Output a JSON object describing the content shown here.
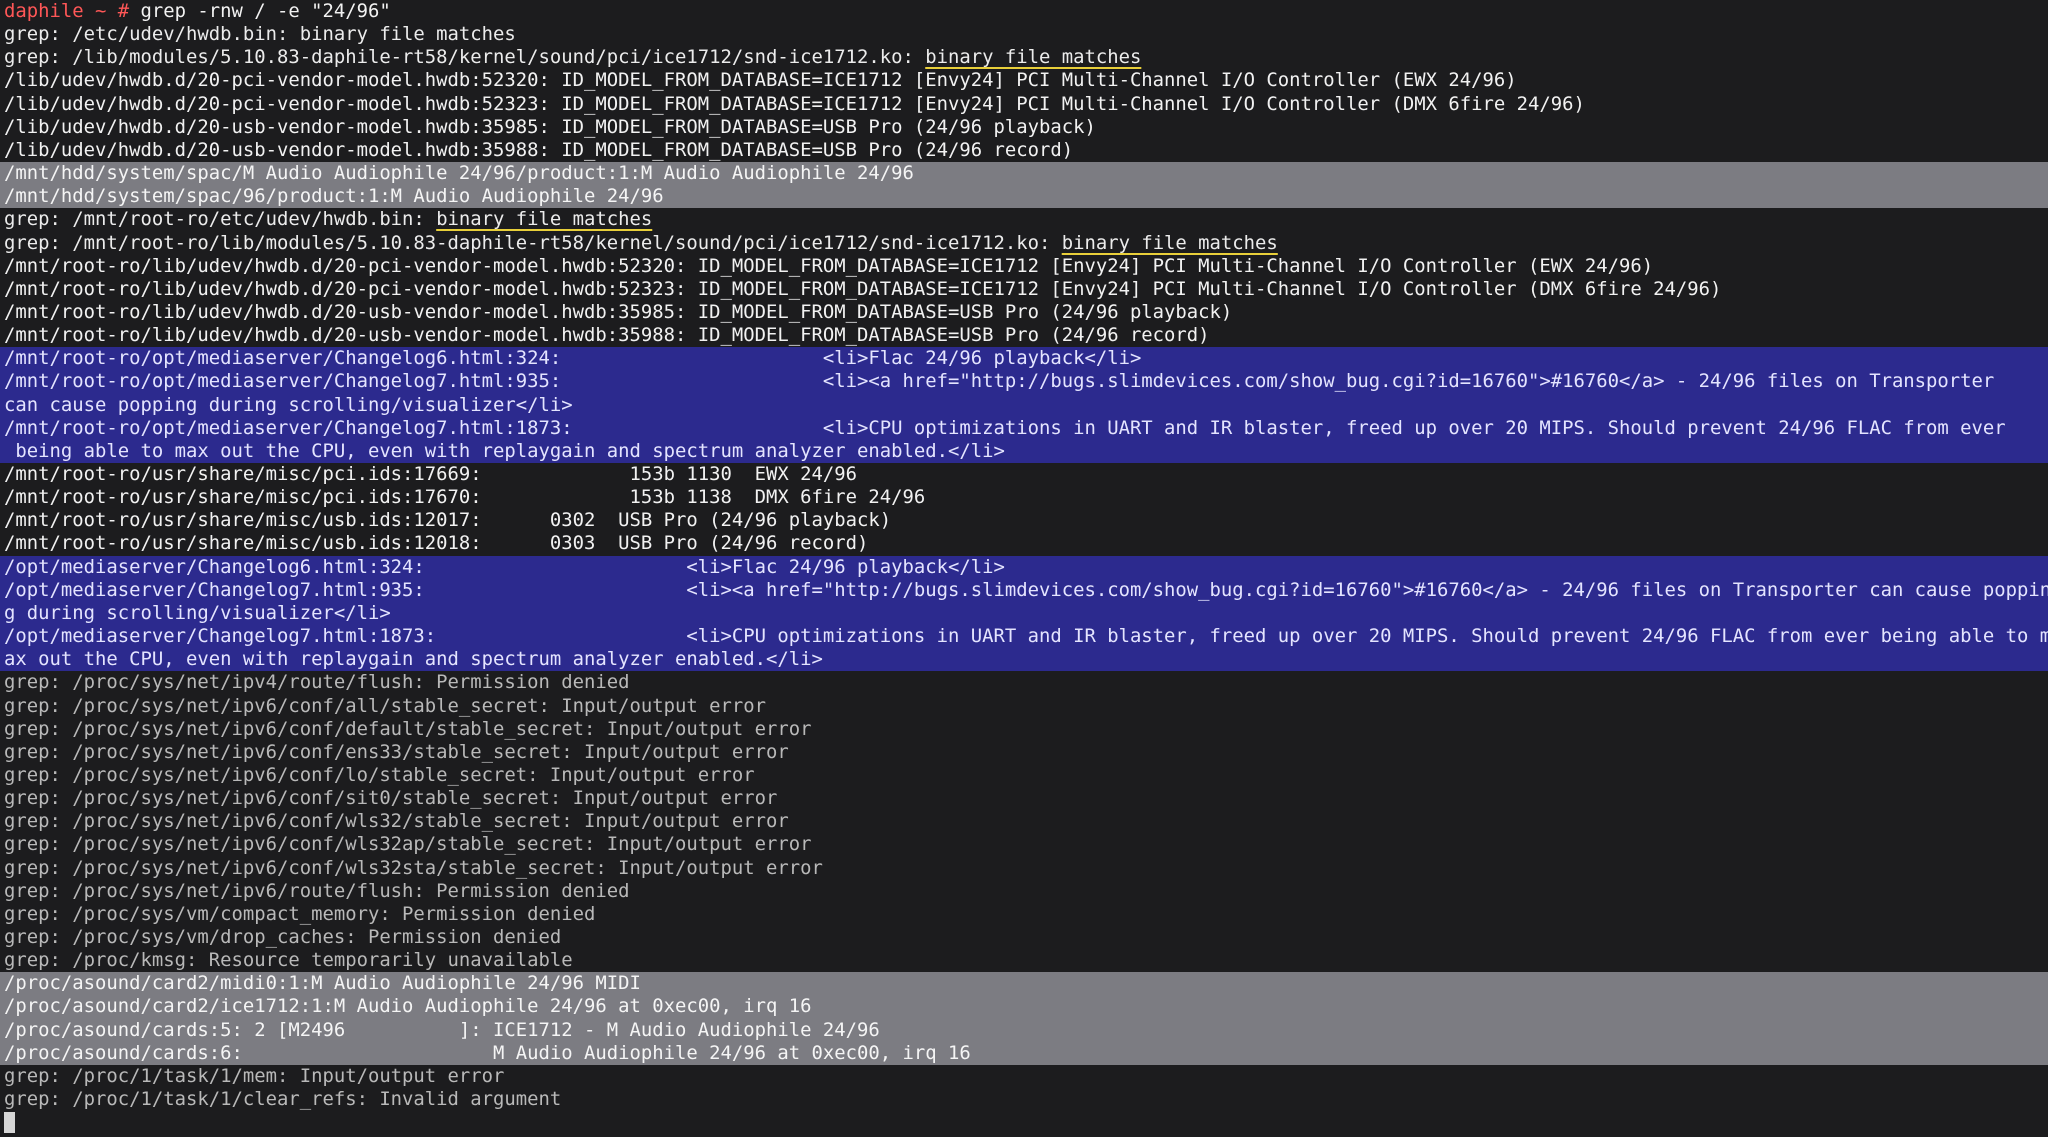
{
  "prompt": {
    "host": "daphile",
    "path_and_symbol": " ~ # ",
    "command": "grep -rnw / -e \"24/96\""
  },
  "lines": [
    {
      "style": "normal",
      "segments": [
        {
          "t": "grep: /etc/udev/hwdb.bin: binary file matches"
        }
      ]
    },
    {
      "style": "normal",
      "segments": [
        {
          "t": "grep: /lib/modules/5.10.83-daphile-rt58/kernel/sound/pci/ice1712/snd-ice1712.ko: "
        },
        {
          "t": "binary file matches",
          "hl": true
        }
      ]
    },
    {
      "style": "bright",
      "segments": [
        {
          "t": "/lib/udev/hwdb.d/20-pci-vendor-model.hwdb:52320: ID_MODEL_FROM_DATABASE=ICE1712 [Envy24] PCI Multi-Channel I/O Controller (EWX 24/96)"
        }
      ]
    },
    {
      "style": "bright",
      "segments": [
        {
          "t": "/lib/udev/hwdb.d/20-pci-vendor-model.hwdb:52323: ID_MODEL_FROM_DATABASE=ICE1712 [Envy24] PCI Multi-Channel I/O Controller (DMX 6fire 24/96)"
        }
      ]
    },
    {
      "style": "bright",
      "segments": [
        {
          "t": "/lib/udev/hwdb.d/20-usb-vendor-model.hwdb:35985: ID_MODEL_FROM_DATABASE=USB Pro (24/96 playback)"
        }
      ]
    },
    {
      "style": "bright",
      "segments": [
        {
          "t": "/lib/udev/hwdb.d/20-usb-vendor-model.hwdb:35988: ID_MODEL_FROM_DATABASE=USB Pro (24/96 record)"
        }
      ]
    },
    {
      "style": "gray",
      "segments": [
        {
          "t": "/mnt/hdd/system/spac/M Audio Audiophile 24/96/product:1:M Audio Audiophile 24/96"
        }
      ]
    },
    {
      "style": "gray",
      "segments": [
        {
          "t": "/mnt/hdd/system/spac/96/product:1:M Audio Audiophile 24/96"
        }
      ]
    },
    {
      "style": "normal",
      "segments": [
        {
          "t": "grep: /mnt/root-ro/etc/udev/hwdb.bin: "
        },
        {
          "t": "binary file matches",
          "hl": true
        }
      ]
    },
    {
      "style": "normal",
      "segments": [
        {
          "t": "grep: /mnt/root-ro/lib/modules/5.10.83-daphile-rt58/kernel/sound/pci/ice1712/snd-ice1712.ko: "
        },
        {
          "t": "binary file matches",
          "hl": true
        }
      ]
    },
    {
      "style": "bright",
      "segments": [
        {
          "t": "/mnt/root-ro/lib/udev/hwdb.d/20-pci-vendor-model.hwdb:52320: ID_MODEL_FROM_DATABASE=ICE1712 [Envy24] PCI Multi-Channel I/O Controller (EWX 24/96)"
        }
      ]
    },
    {
      "style": "bright",
      "segments": [
        {
          "t": "/mnt/root-ro/lib/udev/hwdb.d/20-pci-vendor-model.hwdb:52323: ID_MODEL_FROM_DATABASE=ICE1712 [Envy24] PCI Multi-Channel I/O Controller (DMX 6fire 24/96)"
        }
      ]
    },
    {
      "style": "bright",
      "segments": [
        {
          "t": "/mnt/root-ro/lib/udev/hwdb.d/20-usb-vendor-model.hwdb:35985: ID_MODEL_FROM_DATABASE=USB Pro (24/96 playback)"
        }
      ]
    },
    {
      "style": "bright",
      "segments": [
        {
          "t": "/mnt/root-ro/lib/udev/hwdb.d/20-usb-vendor-model.hwdb:35988: ID_MODEL_FROM_DATABASE=USB Pro (24/96 record)"
        }
      ]
    },
    {
      "style": "blue",
      "segments": [
        {
          "t": "/mnt/root-ro/opt/mediaserver/Changelog6.html:324:                       <li>Flac 24/96 playback</li>"
        }
      ]
    },
    {
      "style": "blue",
      "segments": [
        {
          "t": "/mnt/root-ro/opt/mediaserver/Changelog7.html:935:                       <li><a href=\"http://bugs.slimdevices.com/show_bug.cgi?id=16760\">#16760</a> - 24/96 files on Transporter"
        }
      ]
    },
    {
      "style": "blue",
      "segments": [
        {
          "t": "can cause popping during scrolling/visualizer</li>"
        }
      ]
    },
    {
      "style": "blue",
      "segments": [
        {
          "t": "/mnt/root-ro/opt/mediaserver/Changelog7.html:1873:                      <li>CPU optimizations in UART and IR blaster, freed up over 20 MIPS. Should prevent 24/96 FLAC from ever"
        }
      ]
    },
    {
      "style": "blue",
      "segments": [
        {
          "t": " being able to max out the CPU, even with replaygain and spectrum analyzer enabled.</li>"
        }
      ]
    },
    {
      "style": "bright",
      "segments": [
        {
          "t": "/mnt/root-ro/usr/share/misc/pci.ids:17669:             153b 1130  EWX 24/96"
        }
      ]
    },
    {
      "style": "bright",
      "segments": [
        {
          "t": "/mnt/root-ro/usr/share/misc/pci.ids:17670:             153b 1138  DMX 6fire 24/96"
        }
      ]
    },
    {
      "style": "bright",
      "segments": [
        {
          "t": "/mnt/root-ro/usr/share/misc/usb.ids:12017:      0302  USB Pro (24/96 playback)"
        }
      ]
    },
    {
      "style": "bright",
      "segments": [
        {
          "t": "/mnt/root-ro/usr/share/misc/usb.ids:12018:      0303  USB Pro (24/96 record)"
        }
      ]
    },
    {
      "style": "blue",
      "segments": [
        {
          "t": "/opt/mediaserver/Changelog6.html:324:                       <li>Flac 24/96 playback</li>"
        }
      ]
    },
    {
      "style": "blue",
      "segments": [
        {
          "t": "/opt/mediaserver/Changelog7.html:935:                       <li><a href=\"http://bugs.slimdevices.com/show_bug.cgi?id=16760\">#16760</a> - 24/96 files on Transporter can cause poppin"
        }
      ]
    },
    {
      "style": "blue",
      "segments": [
        {
          "t": "g during scrolling/visualizer</li>"
        }
      ]
    },
    {
      "style": "blue",
      "segments": [
        {
          "t": "/opt/mediaserver/Changelog7.html:1873:                      <li>CPU optimizations in UART and IR blaster, freed up over 20 MIPS. Should prevent 24/96 FLAC from ever being able to m"
        }
      ]
    },
    {
      "style": "blue",
      "segments": [
        {
          "t": "ax out the CPU, even with replaygain and spectrum analyzer enabled.</li>"
        }
      ]
    },
    {
      "style": "dim",
      "segments": [
        {
          "t": "grep: /proc/sys/net/ipv4/route/flush: Permission denied"
        }
      ]
    },
    {
      "style": "dim",
      "segments": [
        {
          "t": "grep: /proc/sys/net/ipv6/conf/all/stable_secret: Input/output error"
        }
      ]
    },
    {
      "style": "dim",
      "segments": [
        {
          "t": "grep: /proc/sys/net/ipv6/conf/default/stable_secret: Input/output error"
        }
      ]
    },
    {
      "style": "dim",
      "segments": [
        {
          "t": "grep: /proc/sys/net/ipv6/conf/ens33/stable_secret: Input/output error"
        }
      ]
    },
    {
      "style": "dim",
      "segments": [
        {
          "t": "grep: /proc/sys/net/ipv6/conf/lo/stable_secret: Input/output error"
        }
      ]
    },
    {
      "style": "dim",
      "segments": [
        {
          "t": "grep: /proc/sys/net/ipv6/conf/sit0/stable_secret: Input/output error"
        }
      ]
    },
    {
      "style": "dim",
      "segments": [
        {
          "t": "grep: /proc/sys/net/ipv6/conf/wls32/stable_secret: Input/output error"
        }
      ]
    },
    {
      "style": "dim",
      "segments": [
        {
          "t": "grep: /proc/sys/net/ipv6/conf/wls32ap/stable_secret: Input/output error"
        }
      ]
    },
    {
      "style": "dim",
      "segments": [
        {
          "t": "grep: /proc/sys/net/ipv6/conf/wls32sta/stable_secret: Input/output error"
        }
      ]
    },
    {
      "style": "dim",
      "segments": [
        {
          "t": "grep: /proc/sys/net/ipv6/route/flush: Permission denied"
        }
      ]
    },
    {
      "style": "dim",
      "segments": [
        {
          "t": "grep: /proc/sys/vm/compact_memory: Permission denied"
        }
      ]
    },
    {
      "style": "dim",
      "segments": [
        {
          "t": "grep: /proc/sys/vm/drop_caches: Permission denied"
        }
      ]
    },
    {
      "style": "dim",
      "segments": [
        {
          "t": "grep: /proc/kmsg: Resource temporarily unavailable"
        }
      ]
    },
    {
      "style": "gray",
      "segments": [
        {
          "t": "/proc/asound/card2/midi0:1:M Audio Audiophile 24/96 MIDI"
        }
      ]
    },
    {
      "style": "gray",
      "segments": [
        {
          "t": "/proc/asound/card2/ice1712:1:M Audio Audiophile 24/96 at 0xec00, irq 16"
        }
      ]
    },
    {
      "style": "gray",
      "segments": [
        {
          "t": "/proc/asound/cards:5: 2 [M2496          ]: ICE1712 - M Audio Audiophile 24/96"
        }
      ]
    },
    {
      "style": "gray",
      "segments": [
        {
          "t": "/proc/asound/cards:6:                      M Audio Audiophile 24/96 at 0xec00, irq 16"
        }
      ]
    },
    {
      "style": "dim",
      "segments": [
        {
          "t": "grep: /proc/1/task/1/mem: Input/output error"
        }
      ]
    },
    {
      "style": "dim",
      "segments": [
        {
          "t": "grep: /proc/1/task/1/clear_refs: Invalid argument"
        }
      ]
    }
  ]
}
